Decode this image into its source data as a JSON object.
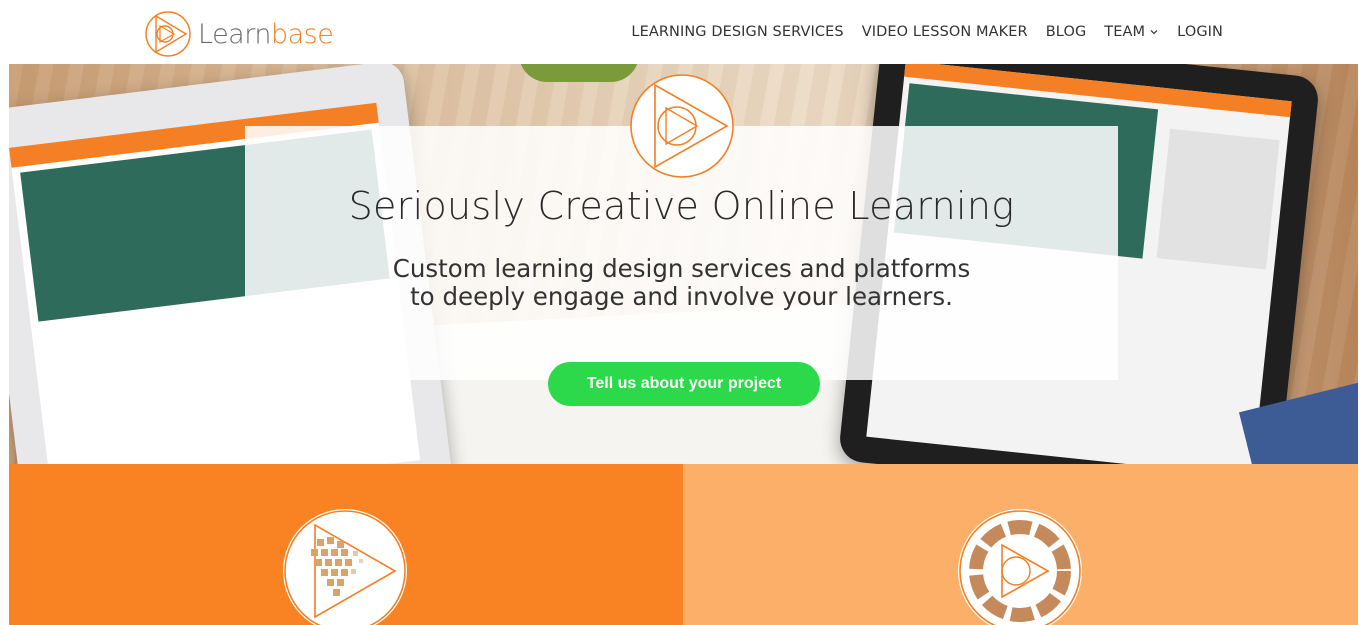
{
  "brand": {
    "name_part1": "Learn",
    "name_part2": "base",
    "accent_color": "#f47f24",
    "logo_icon": "learnbase-play-triangle-icon"
  },
  "nav": {
    "items": [
      {
        "label": "LEARNING DESIGN SERVICES"
      },
      {
        "label": "VIDEO LESSON MAKER"
      },
      {
        "label": "BLOG"
      },
      {
        "label": "TEAM",
        "has_dropdown": true,
        "icon": "chevron-down-icon"
      },
      {
        "label": "LOGIN"
      }
    ]
  },
  "hero": {
    "title": "Seriously Creative Online Learning",
    "subtitle_line1": "Custom learning design services and platforms",
    "subtitle_line2": "to deeply engage and involve your learners.",
    "cta_label": "Tell us about your project",
    "cta_color": "#2bd94a",
    "background": "desk-with-tablets-photo"
  },
  "tiles": [
    {
      "background": "#f98223",
      "icon": "pixel-heart-play-icon"
    },
    {
      "background": "#fbaf68",
      "icon": "hands-circle-play-icon"
    }
  ]
}
